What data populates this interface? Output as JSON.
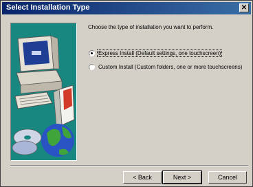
{
  "window": {
    "title": "Select Installation Type",
    "close_glyph": "✕"
  },
  "prompt": "Choose the type of installation you want to perform.",
  "options": [
    {
      "label": "Express Install (Default settings, one touchscreen)",
      "checked": true
    },
    {
      "label": "Custom Install (Custom folders, one or more touchscreens)",
      "checked": false
    }
  ],
  "buttons": {
    "back": "< Back",
    "next": "Next >",
    "cancel": "Cancel"
  },
  "illustration": {
    "icons": [
      "computer-icon",
      "cd-icon",
      "globe-icon"
    ],
    "background": "#17877f"
  }
}
